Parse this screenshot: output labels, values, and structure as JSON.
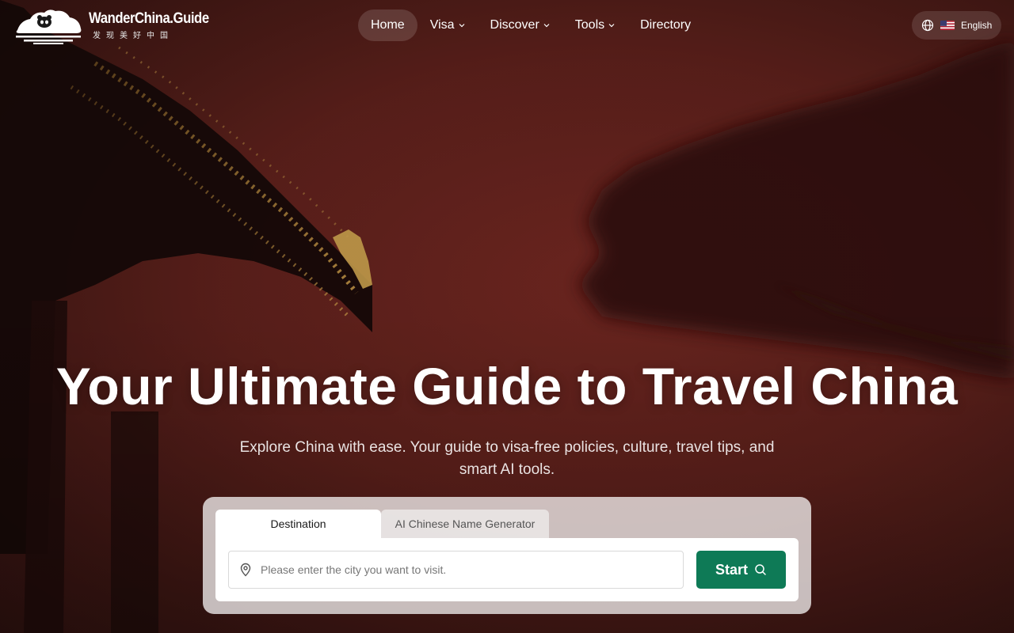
{
  "brand": {
    "name": "WanderChina.Guide",
    "tagline": "发现美好中国"
  },
  "nav": {
    "items": [
      {
        "label": "Home",
        "active": true,
        "dropdown": false
      },
      {
        "label": "Visa",
        "active": false,
        "dropdown": true
      },
      {
        "label": "Discover",
        "active": false,
        "dropdown": true
      },
      {
        "label": "Tools",
        "active": false,
        "dropdown": true
      },
      {
        "label": "Directory",
        "active": false,
        "dropdown": false
      }
    ]
  },
  "language": {
    "label": "English",
    "icon": "globe-icon",
    "flag": "us-flag-icon"
  },
  "hero": {
    "title": "Your Ultimate Guide to Travel China",
    "subtitle": "Explore China with ease. Your guide to visa-free policies, culture, travel tips, and smart AI tools."
  },
  "search": {
    "tabs": [
      {
        "label": "Destination",
        "active": true
      },
      {
        "label": "AI Chinese Name Generator",
        "active": false
      }
    ],
    "placeholder": "Please enter the city you want to visit.",
    "value": "",
    "button_label": "Start",
    "location_icon": "map-pin-icon",
    "search_icon": "search-icon"
  },
  "colors": {
    "background": "#5a1f1a",
    "accent": "#0e7a56"
  }
}
